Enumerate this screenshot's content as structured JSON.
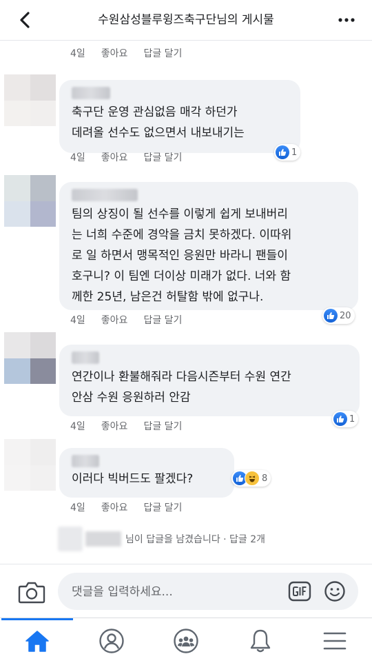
{
  "header": {
    "title": "수원삼성블루윙즈축구단님의 게시물"
  },
  "actions": {
    "time": "4일",
    "like": "좋아요",
    "reply": "답글 달기"
  },
  "comments": [
    {
      "text": "축구단 운영 관심없음 매각 하던가\n데려올 선수도 없으면서 내보내기는",
      "reaction_count": "1",
      "time": "4일"
    },
    {
      "text": "팀의 상징이 될 선수를 이렇게 쉽게 보내버리\n는 너희 수준에 경악을 금치 못하겠다. 이따위\n로 일 하면서 맹목적인 응원만 바라니 팬들이\n호구니? 이 팀엔 더이상 미래가 없다. 너와 함\n께한 25년, 남은건 허탈함 밖에 없구나.",
      "reaction_count": "20",
      "time": "4일"
    },
    {
      "text": "연간이나 환불해줘라 다음시즌부터 수원 연간\n안삼 수원 응원하러 안감",
      "reaction_count": "1",
      "time": "4일"
    },
    {
      "text": "이러다 빅버드도 팔겠다?",
      "reaction_count": "8",
      "time": "4일"
    }
  ],
  "replies_summary": {
    "text": "님이 답글을 남겼습니다 · 답글 2개"
  },
  "composer": {
    "placeholder": "댓글을 입력하세요..."
  },
  "tabs": [
    {
      "icon": "home-icon",
      "active": true
    },
    {
      "icon": "profile-icon",
      "active": false
    },
    {
      "icon": "groups-icon",
      "active": false
    },
    {
      "icon": "bell-icon",
      "active": false
    },
    {
      "icon": "menu-icon",
      "active": false
    }
  ],
  "colors": {
    "accent": "#1877f2",
    "bubble": "#f0f2f5",
    "muted": "#65676b"
  }
}
